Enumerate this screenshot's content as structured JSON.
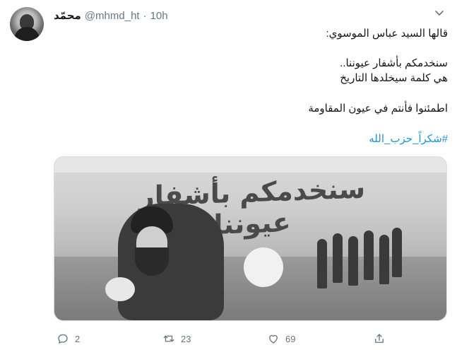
{
  "tweet": {
    "author": {
      "display_name": "محمّد",
      "handle": "@mhmd_ht",
      "time": "10h"
    },
    "separator": "·",
    "lines": [
      "قالها السيد عباس الموسوي:",
      "سنخدمكم بأشفار عيوننا..",
      "هي كلمة سيخلدها التاريخ",
      "اطمئنوا فأنتم في عيون المقاومة"
    ],
    "hashtag": "#شكراً_حزب_الله",
    "media": {
      "banner_text": "سنخدمكم بأشفار عيوننا"
    },
    "actions": {
      "replies": "2",
      "retweets": "23",
      "likes": "69"
    }
  },
  "colors": {
    "link": "#1b95e0",
    "muted": "#657786",
    "text": "#14171a"
  },
  "icons": [
    "chevron-down-icon",
    "reply-icon",
    "retweet-icon",
    "like-icon",
    "share-icon"
  ]
}
